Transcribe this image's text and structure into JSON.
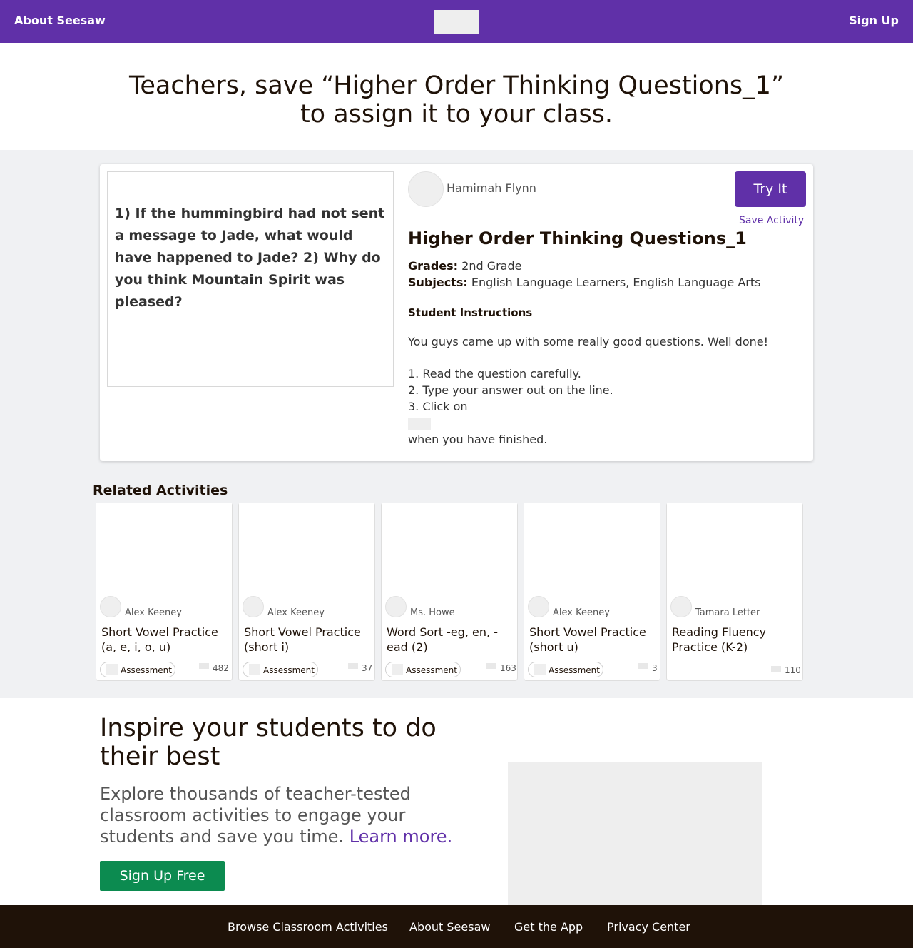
{
  "header": {
    "about_label": "About Seesaw",
    "signup_label": "Sign Up",
    "logo_icon": "seesaw-logo"
  },
  "hero": {
    "title": "Teachers, save “Higher Order Thinking Questions_1” to assign it to your class."
  },
  "activity": {
    "preview_text": "1) If the hummingbird had not sent a message to Jade, what would have happened to Jade? 2) Why do you think Mountain Spirit was pleased?",
    "author": "Hamimah Flynn",
    "try_label": "Try It",
    "save_label": "Save Activity",
    "title": "Higher Order Thinking Questions_1",
    "grades_label": "Grades:",
    "grades_value": "2nd Grade",
    "subjects_label": "Subjects:",
    "subjects_value": "English Language Learners, English Language Arts",
    "instructions_heading": "Student Instructions",
    "instructions": [
      "You guys came up with some really good questions. Well done!",
      "1. Read the question carefully.",
      "2. Type your answer out on the line.",
      "3. Click on",
      "when you have finished."
    ]
  },
  "related": {
    "heading": "Related Activities",
    "items": [
      {
        "author": "Alex Keeney",
        "title": "Short Vowel Practice (a, e, i, o, u)",
        "tag": "Assessment",
        "count": "482"
      },
      {
        "author": "Alex Keeney",
        "title": "Short Vowel Practice (short i)",
        "tag": "Assessment",
        "count": "37"
      },
      {
        "author": "Ms. Howe",
        "title": "Word Sort -eg, en, -ead (2)",
        "tag": "Assessment",
        "count": "163"
      },
      {
        "author": "Alex Keeney",
        "title": "Short Vowel Practice (short u)",
        "tag": "Assessment",
        "count": "3"
      },
      {
        "author": "Tamara Letter",
        "title": "Reading Fluency Practice (K-2)",
        "tag": "",
        "count": "110"
      }
    ]
  },
  "promo": {
    "heading": "Inspire your students to do their best",
    "body": "Explore thousands of teacher-tested classroom activities to engage your students and save you time.",
    "learn_more": "Learn more.",
    "signup_label": "Sign Up Free"
  },
  "footer": {
    "links": [
      "Browse Classroom Activities",
      "About Seesaw",
      "Get the App",
      "Privacy Center"
    ]
  },
  "colors": {
    "brand_purple": "#6030a8",
    "signup_green": "#0c8b50",
    "footer_dark": "#1f1208",
    "band_gray": "#f0f1f3"
  }
}
